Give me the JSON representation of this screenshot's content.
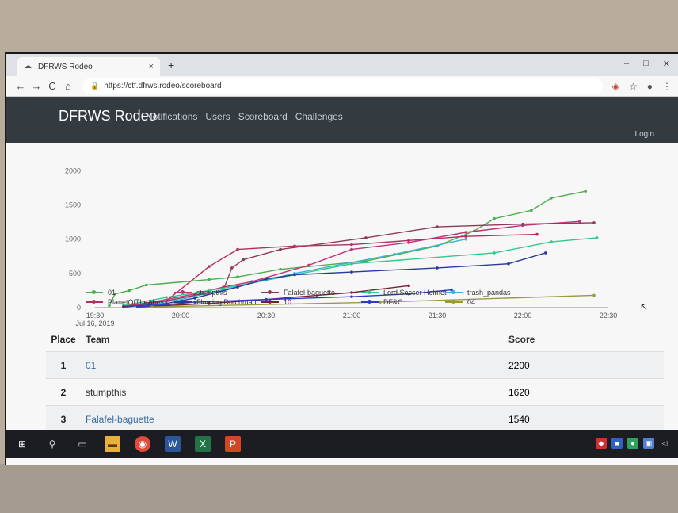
{
  "browser": {
    "tab_title": "DFRWS Rodeo",
    "tab_close": "×",
    "new_tab": "+",
    "url": "https://ctf.dfrws.rodeo/scoreboard",
    "nav": {
      "back": "←",
      "forward": "→",
      "reload": "C",
      "home": "⌂"
    },
    "window_controls": [
      "–",
      "□",
      "✕"
    ]
  },
  "site": {
    "brand": "DFRWS Rodeo",
    "nav_links": [
      "Notifications",
      "Users",
      "Scoreboard",
      "Challenges"
    ],
    "login": "Login"
  },
  "chart_data": {
    "type": "line",
    "title": "",
    "xlabel": "",
    "ylabel": "",
    "ylim": [
      0,
      2200
    ],
    "yticks": [
      "0",
      "500",
      "1000",
      "1500",
      "2000"
    ],
    "xticks": [
      "19:30\nJul 16, 2019",
      "20:00",
      "20:30",
      "21:00",
      "21:30",
      "22:00",
      "22:30"
    ],
    "x_time_minutes_after_19_30": "not used",
    "grid": false,
    "legend_position": "bottom",
    "series": [
      {
        "name": "01",
        "color": "#4cae4c",
        "x": [
          "19:35",
          "19:37",
          "19:42",
          "19:48",
          "20:10",
          "20:20",
          "20:35",
          "21:05",
          "21:30",
          "21:43",
          "21:50",
          "22:03",
          "22:10",
          "22:22"
        ],
        "y": [
          30,
          200,
          250,
          330,
          410,
          450,
          560,
          680,
          900,
          1120,
          1300,
          1420,
          1600,
          1700
        ]
      },
      {
        "name": "stumpthis",
        "color": "#c2327a",
        "x": [
          "19:40",
          "19:50",
          "20:05",
          "20:15",
          "20:25",
          "20:45",
          "21:00",
          "21:20",
          "21:40",
          "22:00",
          "22:20"
        ],
        "y": [
          20,
          80,
          200,
          300,
          380,
          620,
          850,
          950,
          1100,
          1200,
          1260
        ]
      },
      {
        "name": "Falafel-baguette",
        "color": "#8e3a5a",
        "x": [
          "19:40",
          "19:50",
          "20:05",
          "20:15",
          "20:18",
          "20:22",
          "20:35",
          "21:05",
          "21:30",
          "22:00",
          "22:25"
        ],
        "y": [
          20,
          60,
          180,
          260,
          580,
          700,
          850,
          1020,
          1180,
          1220,
          1240
        ]
      },
      {
        "name": "Lord Soccer Helmet",
        "color": "#2fc98a",
        "x": [
          "19:40",
          "19:55",
          "20:10",
          "20:20",
          "21:00",
          "21:50",
          "22:10",
          "22:26"
        ],
        "y": [
          30,
          150,
          250,
          320,
          640,
          800,
          960,
          1020
        ]
      },
      {
        "name": "trash_pandas",
        "color": "#3cb4cf",
        "x": [
          "19:45",
          "20:00",
          "20:15",
          "20:40",
          "21:15",
          "21:40"
        ],
        "y": [
          20,
          120,
          260,
          500,
          780,
          1000
        ]
      },
      {
        "name": "PlanetOfTheAbes",
        "color": "#b03060",
        "x": [
          "19:40",
          "19:55",
          "20:10",
          "20:20",
          "20:40",
          "21:00",
          "21:20",
          "21:40",
          "22:05"
        ],
        "y": [
          20,
          100,
          600,
          850,
          900,
          920,
          980,
          1040,
          1070
        ]
      },
      {
        "name": "Floating Dutchman",
        "color": "#2b3a9a",
        "x": [
          "19:40",
          "19:55",
          "20:05",
          "20:20",
          "20:30",
          "20:40",
          "21:00",
          "21:30",
          "21:55",
          "22:08"
        ],
        "y": [
          10,
          60,
          140,
          300,
          420,
          480,
          520,
          580,
          640,
          800
        ]
      },
      {
        "name": "10",
        "color": "#7a1e3a",
        "x": [
          "19:45",
          "20:10",
          "20:30",
          "21:00",
          "21:20"
        ],
        "y": [
          10,
          60,
          120,
          220,
          320
        ]
      },
      {
        "name": "DF&C",
        "color": "#2a3ac8",
        "x": [
          "19:45",
          "20:05",
          "20:30",
          "21:00",
          "21:20",
          "21:35"
        ],
        "y": [
          10,
          80,
          120,
          160,
          200,
          260
        ]
      },
      {
        "name": "04",
        "color": "#9a9a3a",
        "x": [
          "19:50",
          "21:10",
          "22:25"
        ],
        "y": [
          10,
          80,
          180
        ]
      }
    ]
  },
  "scoreboard": {
    "headers": {
      "place": "Place",
      "team": "Team",
      "score": "Score"
    },
    "rows": [
      {
        "place": "1",
        "team": "01",
        "score": "2200"
      },
      {
        "place": "2",
        "team": "stumpthis",
        "score": "1620"
      },
      {
        "place": "3",
        "team": "Falafel-baguette",
        "score": "1540"
      }
    ]
  },
  "taskbar": {
    "icons": [
      "windows-icon",
      "search-icon",
      "task-view-icon",
      "file-explorer-icon",
      "chrome-icon",
      "word-icon",
      "excel-icon",
      "powerpoint-icon"
    ],
    "tray": [
      "shield-icon",
      "app-icon",
      "network-icon",
      "display-icon",
      "volume-icon"
    ]
  }
}
